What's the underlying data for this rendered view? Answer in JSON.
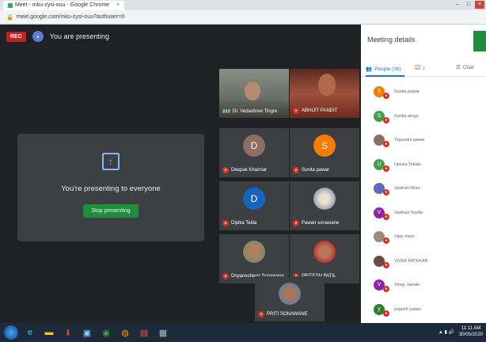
{
  "browser": {
    "tab_title": "Meet - mku-zysi-ouu - Google Chrome",
    "url": "meet.google.com/mku-zysi-ouu?authuser=0"
  },
  "meet": {
    "rec_label": "REC",
    "presenting_label": "You are presenting",
    "present_message": "You're presenting to everyone",
    "stop_presenting": "Stop presenting"
  },
  "tiles": [
    {
      "name": "Dr. Vedashree Tingre",
      "kind": "video-a"
    },
    {
      "name": "ABHIJIT PANDIT",
      "kind": "video-b"
    },
    {
      "name": "Deepak Khairnar",
      "kind": "letter",
      "letter": "D",
      "color": "#8d6e63"
    },
    {
      "name": "Sunita pawar",
      "kind": "letter",
      "letter": "S",
      "color": "#f57c00"
    },
    {
      "name": "Dipika Tekla",
      "kind": "letter",
      "letter": "D",
      "color": "#1565c0"
    },
    {
      "name": "Pawan sonawane",
      "kind": "photo",
      "color": "#9aa0b8"
    },
    {
      "name": "Dnyaneshwar Sonawane",
      "kind": "photo",
      "color": "#6d8f6a"
    },
    {
      "name": "PRITESH PATIL",
      "kind": "photo",
      "color": "#c62828"
    },
    {
      "name": "PRITI SONAWANE",
      "kind": "photo",
      "color": "#5c7fa8"
    }
  ],
  "panel": {
    "title": "Meeting details",
    "people_tab": "People (36)",
    "chat_tab": "Chat",
    "participants": [
      {
        "name": "Sunita pawar",
        "letter": "S",
        "color": "#f57c00"
      },
      {
        "name": "Sunita ahuja",
        "letter": "S",
        "color": "#43a047"
      },
      {
        "name": "Tejaswini pawar",
        "letter": "",
        "color": "#8d6e63"
      },
      {
        "name": "Ujwala Tekale",
        "letter": "U",
        "color": "#43a047"
      },
      {
        "name": "Vaishali More",
        "letter": "",
        "color": "#5c6bc0"
      },
      {
        "name": "Vaishali Tendle",
        "letter": "V",
        "color": "#8e24aa"
      },
      {
        "name": "Vijay more",
        "letter": "",
        "color": "#a1887f"
      },
      {
        "name": "VIVEK PATEKAR",
        "letter": "",
        "color": "#6d4c41"
      },
      {
        "name": "Vinay Jawale",
        "letter": "V",
        "color": "#8e24aa"
      },
      {
        "name": "yogesh yadav",
        "letter": "y",
        "color": "#2e7d32"
      }
    ]
  },
  "taskbar": {
    "time": "11:11 AM",
    "date": "30/05/2020"
  }
}
